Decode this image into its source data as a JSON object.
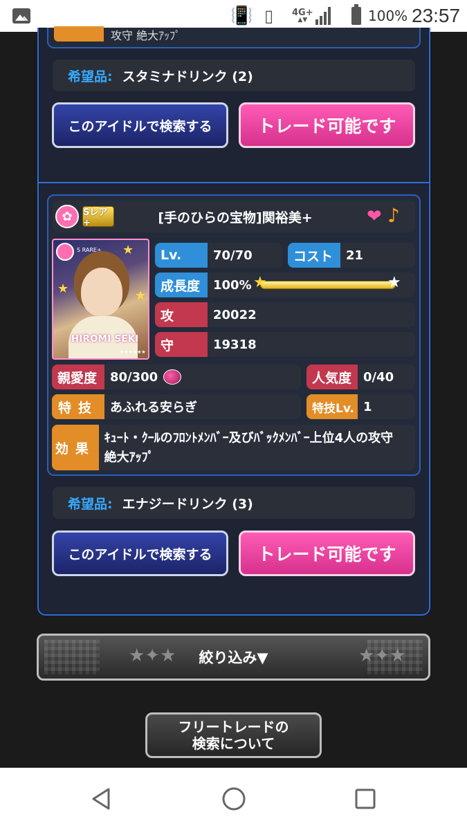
{
  "status_bar": {
    "network": "4G+",
    "battery": "100%",
    "time": "23:57"
  },
  "previous_card": {
    "effect_tail": "攻守 絶大ｱｯﾌﾟ",
    "wish_label": "希望品:",
    "wish_value": "スタミナドリンク (2)",
    "search_button": "このアイドルで検索する",
    "trade_button": "トレード可能です"
  },
  "card": {
    "rarity": "Sレア+",
    "name": "[手のひらの宝物]関裕美+",
    "portrait_signature": "HIROMI SEKI",
    "portrait_rarity": "S RARE+",
    "stats": {
      "lv_label": "Lv.",
      "lv_value": "70/70",
      "cost_label": "コスト",
      "cost_value": "21",
      "growth_label": "成長度",
      "growth_value": "100%",
      "atk_label": "攻",
      "atk_value": "20022",
      "def_label": "守",
      "def_value": "19318",
      "affection_label": "親愛度",
      "affection_value": "80/300",
      "popularity_label": "人気度",
      "popularity_value": "0/40",
      "skill_label": "特技",
      "skill_value": "あふれる安らぎ",
      "skill_lv_label": "特技Lv.",
      "skill_lv_value": "1",
      "effect_label": "効果",
      "effect_value": "ｷｭｰﾄ・ｸｰﾙのﾌﾛﾝﾄﾒﾝﾊﾞｰ及びﾊﾞｯｸﾒﾝﾊﾞｰ上位4人の攻守 絶大ｱｯﾌﾟ"
    },
    "wish_label": "希望品:",
    "wish_value": "エナジードリンク (3)",
    "search_button": "このアイドルで検索する",
    "trade_button": "トレード可能です"
  },
  "filter_button": "絞り込み▼",
  "info_button": "フリートレードの\n検索について",
  "colors": {
    "frame_blue": "#2f6fd6",
    "label_blue": "#2f8fd8",
    "label_red": "#c2384f",
    "label_orange": "#e28d27",
    "trade_pink": "#ff5cb6",
    "search_navy": "#1c2468"
  }
}
